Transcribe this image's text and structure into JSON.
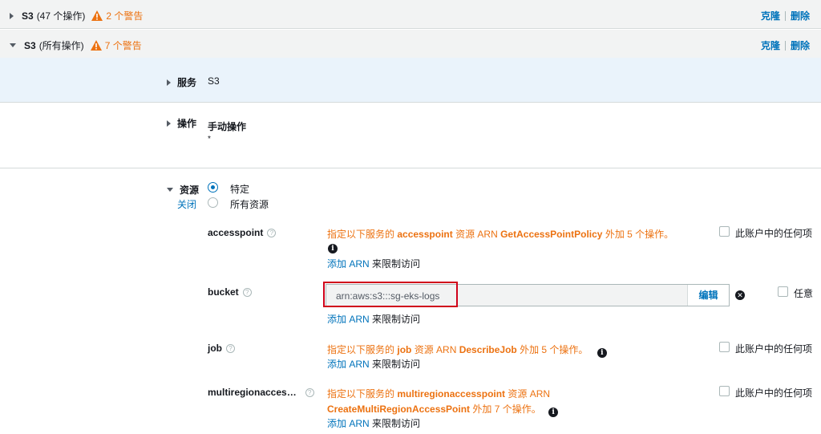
{
  "sections": [
    {
      "name": "S3",
      "count": "(47 个操作)",
      "warning": "2 个警告",
      "clone": "克隆",
      "delete": "删除"
    },
    {
      "name": "S3",
      "count": "(所有操作)",
      "warning": "7 个警告",
      "clone": "克隆",
      "delete": "删除"
    }
  ],
  "service": {
    "label": "服务",
    "value": "S3"
  },
  "actions": {
    "label": "操作",
    "value": "手动操作",
    "sub": "*"
  },
  "resources": {
    "label": "资源",
    "close": "关闭",
    "options": [
      "特定",
      "所有资源"
    ],
    "add_arn": "添加 ARN",
    "restrict": "来限制访问",
    "items": [
      {
        "name": "accesspoint",
        "msg_prefix": "指定以下服务的",
        "resource": "accesspoint",
        "msg_mid": "资源 ARN",
        "action": "GetAccessPointPolicy",
        "msg_suffix": "外加 5 个操作。",
        "any_label": "此账户中的任何项"
      },
      {
        "name": "bucket",
        "arn_value": "arn:aws:s3:::sg-eks-logs",
        "edit": "编辑",
        "any_label": "任意"
      },
      {
        "name": "job",
        "msg_prefix": "指定以下服务的",
        "resource": "job",
        "msg_mid": "资源 ARN",
        "action": "DescribeJob",
        "msg_suffix": "外加 5 个操作。",
        "any_label": "此账户中的任何项"
      },
      {
        "name": "multiregionacces…",
        "msg_prefix": "指定以下服务的",
        "resource": "multiregionaccesspoint",
        "msg_mid": "资源 ARN",
        "action": "CreateMultiRegionAccessPoint",
        "msg_suffix": "外加 7 个操作。",
        "any_label": "此账户中的任何项"
      }
    ]
  }
}
